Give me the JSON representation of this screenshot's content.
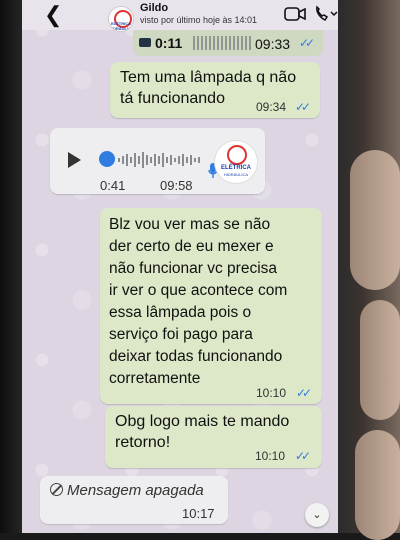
{
  "header": {
    "contact_name": "Gildo",
    "status": "visto por último hoje às 14:01",
    "avatar_text": "ELÉTRICA HIDRÁULICA"
  },
  "audio_message_top": {
    "duration": "0:11",
    "time": "09:33"
  },
  "messages": [
    {
      "text": "Tem uma lâmpada q não\ntá funcionando",
      "time": "09:34"
    },
    {
      "text": "Blz vou ver mas se não\nder certo de eu mexer e\nnão funcionar vc precisa\nir ver o que acontece com\nessa lâmpada pois o\nserviço foi pago para\ndeixar todas funcionando\ncorretamente",
      "time": "10:10"
    },
    {
      "text": "Obg logo mais te mando\nretorno!",
      "time": "10:10"
    }
  ],
  "voice_message": {
    "position": "0:41",
    "time": "09:58",
    "avatar_line1": "ELÉTRICA",
    "avatar_line2": "HIDRÁULICA"
  },
  "deleted_message": {
    "text": "Mensagem apagada",
    "time": "10:17"
  },
  "colors": {
    "outgoing_bubble": "#dde8c8",
    "incoming_bubble": "#eeeef0",
    "read_ticks": "#2f7de1"
  }
}
